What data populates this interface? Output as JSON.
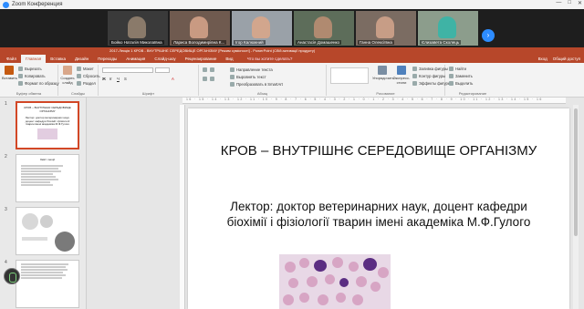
{
  "zoom": {
    "window_title": "Zoom Конференция",
    "participants": [
      {
        "name": "Бойко Наталія Миколаївна"
      },
      {
        "name": "Лариса Володимирівна К..."
      },
      {
        "name": "Ігор Калюжний"
      },
      {
        "name": "Анастасія Домашенко"
      },
      {
        "name": "Ганна Олексіївна"
      },
      {
        "name": "Єлизавета Сколець"
      }
    ]
  },
  "ppt": {
    "title": "2017-Лекція 1 КРОВ - ВНУТРІШНЄ СЕРЕДОВИЩЕ ОРГАНІЗМУ  [Режим сумісності]  -  PowerPoint (Сбій активації продукту)",
    "tabs": [
      "Файл",
      "Главная",
      "Вставка",
      "Дизайн",
      "Переходы",
      "Анимация",
      "Слайд-шоу",
      "Рецензирование",
      "Вид"
    ],
    "search_hint": "Что вы хотите сделать?",
    "right_items": [
      "Вход",
      "Общий доступ"
    ],
    "ribbon": {
      "clipboard": {
        "name": "Буфер обмена",
        "paste": "Вставить",
        "cut": "Вырезать",
        "copy": "Копировать",
        "format": "Формат по образцу"
      },
      "slides": {
        "name": "Слайды",
        "new": "Создать слайд",
        "layout": "Макет",
        "reset": "Сбросить",
        "section": "Раздел"
      },
      "font": {
        "name": "Шрифт"
      },
      "paragraph": {
        "name": "Абзац",
        "direction": "Направление текста",
        "align": "Выровнять текст",
        "smartart": "Преобразовать в SmartArt"
      },
      "drawing": {
        "name": "Рисование",
        "arrange": "Упорядочить",
        "styles": "Экспресс-стили",
        "fill": "Заливка фигуры",
        "outline": "Контур фигуры",
        "effects": "Эффекты фигуры"
      },
      "editing": {
        "name": "Редактирование",
        "find": "Найти",
        "replace": "Заменить",
        "select": "Выделить"
      }
    },
    "ruler": "16 · 15 · 14 · 13 · 12 · 11 · 10 · 9 · 8 · 7 · 6 · 5 · 4 · 3 · 2 · 1 · 0 · 1 · 2 · 3 · 4 · 5 · 6 · 7 · 8 · 9 · 10 · 11 · 12 · 13 · 14 · 15 · 16",
    "thumbnails": [
      {
        "num": "1",
        "title": "КРОВ – ВНУТРІШНЄ СЕРЕДОВИЩЕ ОРГАНІЗМУ",
        "sub": "Лектор: доктор ветеринарних наук, доцент кафедри біохімії і фізіології тварин імені академіка М.Ф.Гулого"
      },
      {
        "num": "2",
        "title": "Зміст лекції",
        "sub": ""
      },
      {
        "num": "3",
        "title": "",
        "sub": ""
      },
      {
        "num": "4",
        "title": "",
        "sub": ""
      }
    ],
    "slide": {
      "title": "КРОВ – ВНУТРІШНЄ СЕРЕДОВИЩЕ ОРГАНІЗМУ",
      "subtitle": "Лектор: доктор ветеринарних наук, доцент кафедри біохімії і фізіології тварин імені академіка М.Ф.Гулого"
    }
  }
}
